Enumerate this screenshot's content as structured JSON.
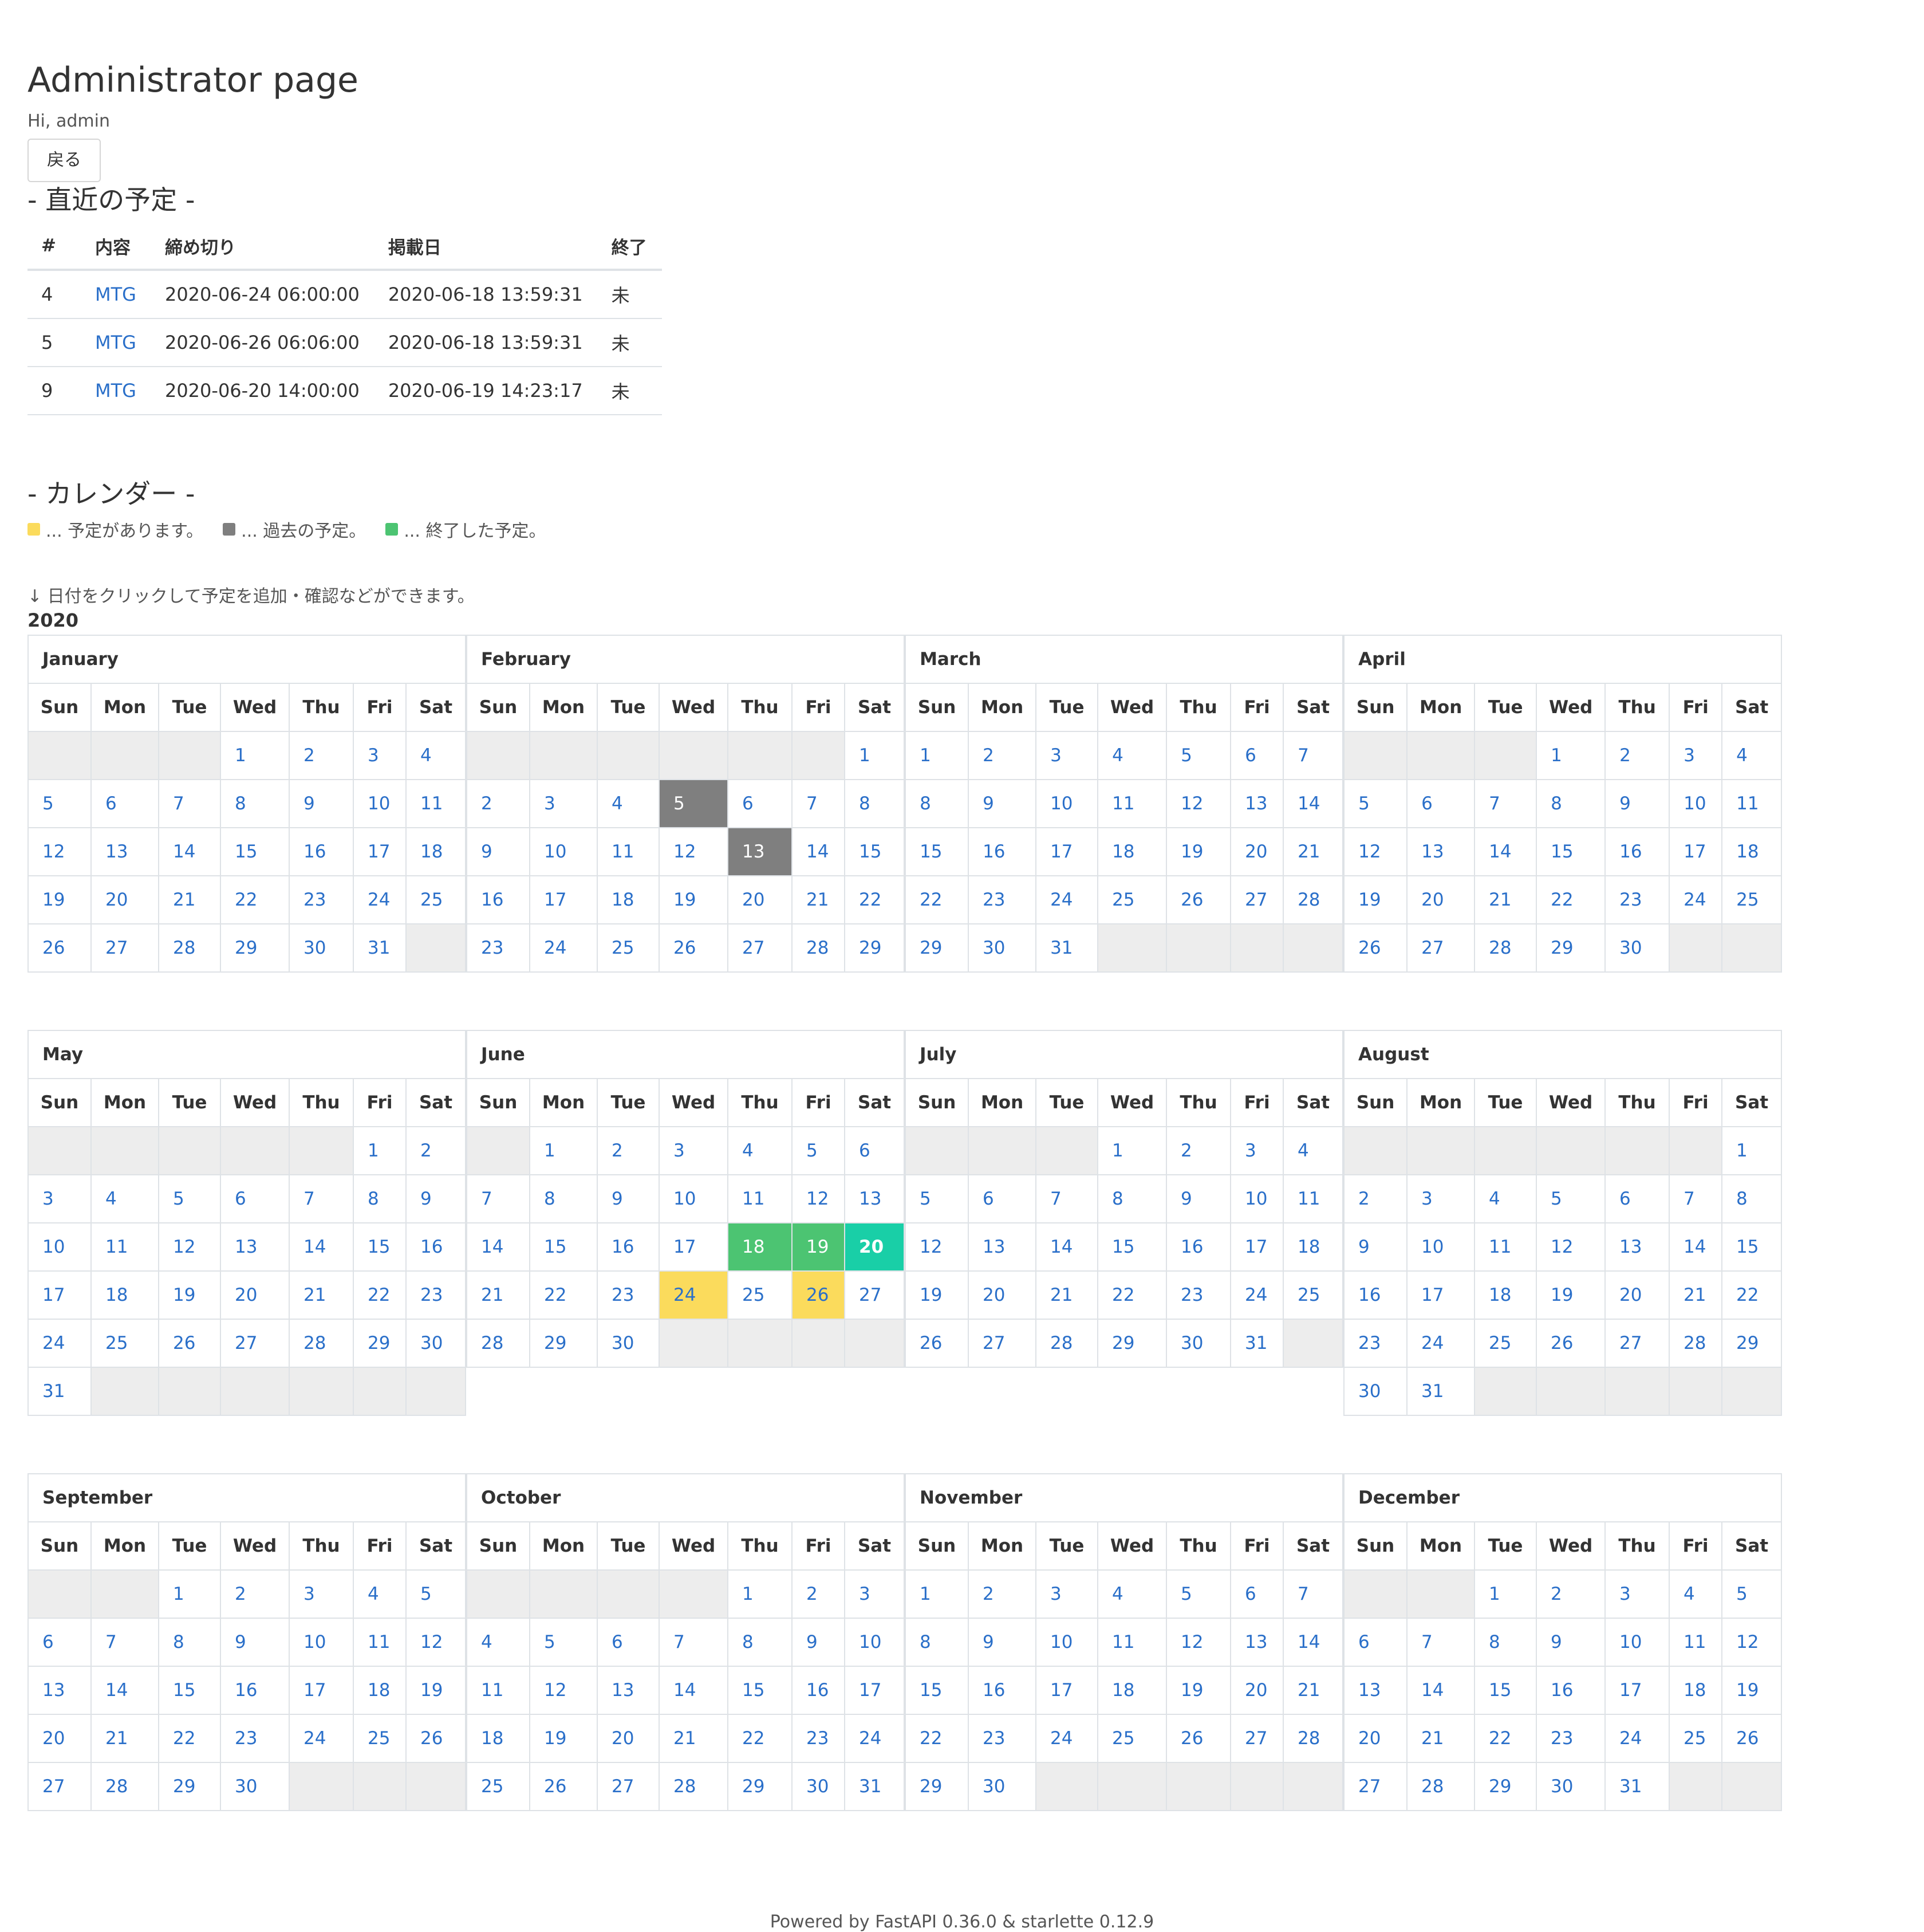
{
  "header": {
    "title": "Administrator page",
    "greeting": "Hi, admin",
    "back_label": "戻る"
  },
  "recent": {
    "title": "- 直近の予定 -",
    "columns": [
      "#",
      "内容",
      "締め切り",
      "掲載日",
      "終了"
    ],
    "rows": [
      {
        "id": "4",
        "content": "MTG",
        "deadline": "2020-06-24 06:00:00",
        "posted": "2020-06-18 13:59:31",
        "done": "未"
      },
      {
        "id": "5",
        "content": "MTG",
        "deadline": "2020-06-26 06:06:00",
        "posted": "2020-06-18 13:59:31",
        "done": "未"
      },
      {
        "id": "9",
        "content": "MTG",
        "deadline": "2020-06-20 14:00:00",
        "posted": "2020-06-19 14:23:17",
        "done": "未"
      }
    ]
  },
  "calendar": {
    "title": "- カレンダー -",
    "legend": [
      {
        "label": "... 予定があります。",
        "color": "#fbdb5c"
      },
      {
        "label": "... 過去の予定。",
        "color": "#7f7f7f"
      },
      {
        "label": "... 終了した予定。",
        "color": "#4cc472"
      }
    ],
    "hint": "↓ 日付をクリックして予定を追加・確認などができます。",
    "year": "2020",
    "weekdays": [
      "Sun",
      "Mon",
      "Tue",
      "Wed",
      "Thu",
      "Fri",
      "Sat"
    ],
    "months": [
      {
        "name": "January",
        "first_weekday": 3,
        "days": 31
      },
      {
        "name": "February",
        "first_weekday": 6,
        "days": 29,
        "marks": {
          "5": "past",
          "13": "past"
        }
      },
      {
        "name": "March",
        "first_weekday": 0,
        "days": 31
      },
      {
        "name": "April",
        "first_weekday": 3,
        "days": 30
      },
      {
        "name": "May",
        "first_weekday": 5,
        "days": 31
      },
      {
        "name": "June",
        "first_weekday": 1,
        "days": 30,
        "marks": {
          "18": "done",
          "19": "done",
          "20": "today",
          "24": "sched",
          "26": "sched"
        }
      },
      {
        "name": "July",
        "first_weekday": 3,
        "days": 31
      },
      {
        "name": "August",
        "first_weekday": 6,
        "days": 31
      },
      {
        "name": "September",
        "first_weekday": 2,
        "days": 30
      },
      {
        "name": "October",
        "first_weekday": 4,
        "days": 31
      },
      {
        "name": "November",
        "first_weekday": 0,
        "days": 30
      },
      {
        "name": "December",
        "first_weekday": 2,
        "days": 31
      }
    ]
  },
  "footer": {
    "text": "Powered by FastAPI 0.36.0 & starlette 0.12.9"
  }
}
